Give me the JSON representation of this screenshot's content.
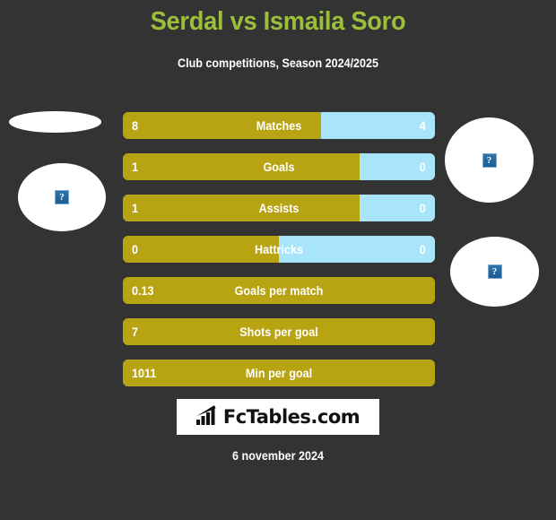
{
  "header": {
    "title": "Serdal vs Ismaila Soro",
    "subtitle": "Club competitions, Season 2024/2025",
    "title_color": "#9cbf3b",
    "subtitle_color": "#ffffff"
  },
  "theme": {
    "background": "#333333",
    "home_color": "#b8a413",
    "away_color": "#a8e5fa",
    "text_color": "#ffffff"
  },
  "players": {
    "home": {
      "name": "Serdal",
      "avatar": "broken-image-placeholder"
    },
    "away": {
      "name": "Ismaila Soro",
      "avatar": "broken-image-placeholder"
    }
  },
  "avatars": [
    {
      "id": "avatar-left-top",
      "side": "home",
      "icon": "broken-image-icon",
      "has_icon": false
    },
    {
      "id": "avatar-left-bottom",
      "side": "home",
      "icon": "broken-image-icon",
      "has_icon": true
    },
    {
      "id": "avatar-right-top",
      "side": "away",
      "icon": "broken-image-icon",
      "has_icon": true
    },
    {
      "id": "avatar-right-bottom",
      "side": "away",
      "icon": "broken-image-icon",
      "has_icon": true
    }
  ],
  "broken_image_glyph": "?",
  "stats": [
    {
      "label": "Matches",
      "home": "8",
      "away": "4",
      "home_pct": 63.5,
      "split": true
    },
    {
      "label": "Goals",
      "home": "1",
      "away": "0",
      "home_pct": 76.0,
      "split": true
    },
    {
      "label": "Assists",
      "home": "1",
      "away": "0",
      "home_pct": 76.0,
      "split": true
    },
    {
      "label": "Hattricks",
      "home": "0",
      "away": "0",
      "home_pct": 50.0,
      "split": true
    },
    {
      "label": "Goals per match",
      "home": "0.13",
      "away": "",
      "home_pct": 100,
      "split": false
    },
    {
      "label": "Shots per goal",
      "home": "7",
      "away": "",
      "home_pct": 100,
      "split": false
    },
    {
      "label": "Min per goal",
      "home": "1011",
      "away": "",
      "home_pct": 100,
      "split": false
    }
  ],
  "logo": {
    "text": "FcTables.com",
    "icon": "bar-chart-icon"
  },
  "footer": {
    "date": "6 november 2024"
  }
}
